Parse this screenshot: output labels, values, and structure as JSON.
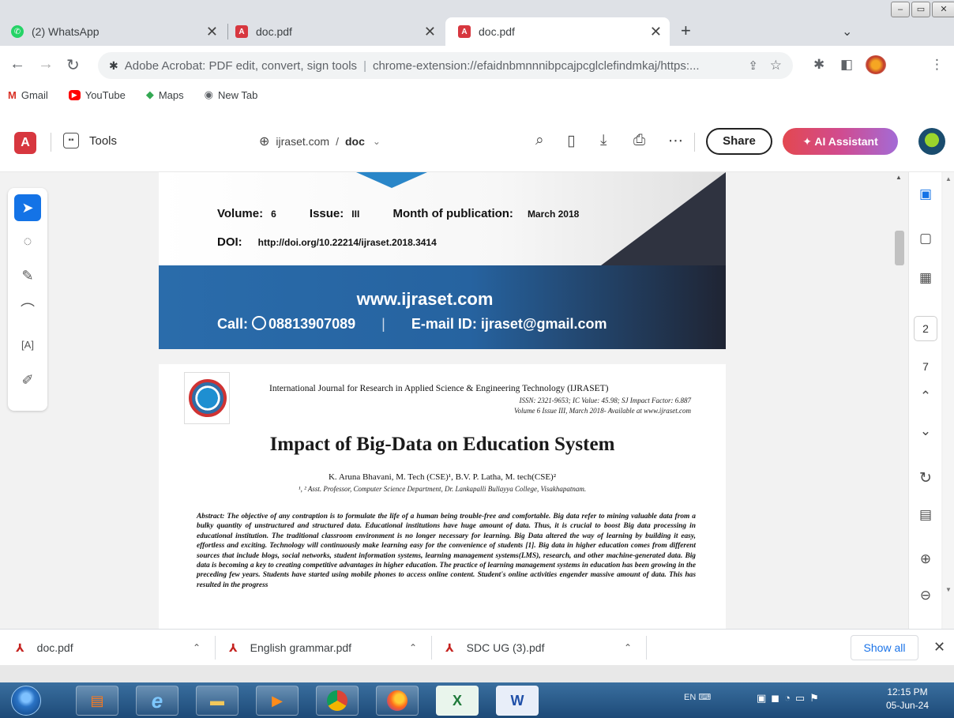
{
  "browser": {
    "tabs": [
      {
        "title": "(2) WhatsApp",
        "icon": "whatsapp-icon",
        "active": false
      },
      {
        "title": "doc.pdf",
        "icon": "acrobat-icon",
        "active": false
      },
      {
        "title": "doc.pdf",
        "icon": "acrobat-icon",
        "active": true
      }
    ],
    "address_prefix": "Adobe Acrobat: PDF edit, convert, sign tools",
    "address_url": "chrome-extension://efaidnbmnnnibpcajpcglclefindmkaj/https:...",
    "bookmarks": [
      {
        "label": "Gmail",
        "icon": "gmail-icon"
      },
      {
        "label": "YouTube",
        "icon": "youtube-icon"
      },
      {
        "label": "Maps",
        "icon": "maps-icon"
      },
      {
        "label": "New Tab",
        "icon": "globe-icon"
      }
    ]
  },
  "acrobat": {
    "tools_label": "Tools",
    "domain": "ijraset.com",
    "doc_name": "doc",
    "share_label": "Share",
    "ai_label": "AI Assistant",
    "current_page": "2",
    "total_pages": "7",
    "accent_color": "#1473e6",
    "brand_color": "#d7373f"
  },
  "page1": {
    "volume_label": "Volume:",
    "volume_value": "6",
    "issue_label": "Issue:",
    "issue_value": "III",
    "month_label": "Month of publication:",
    "month_value": "March 2018",
    "doi_label": "DOI:",
    "doi_value": "http://doi.org/10.22214/ijraset.2018.3414",
    "website": "www.ijraset.com",
    "call_label": "Call:",
    "phone": "08813907089",
    "email": "E-mail ID: ijraset@gmail.com"
  },
  "page2": {
    "journal": "International Journal for Research in Applied Science & Engineering Technology (IJRASET)",
    "issn": "ISSN: 2321-9653; IC Value: 45.98; SJ Impact Factor: 6.887",
    "volume": "Volume 6 Issue III, March 2018- Available at www.ijraset.com",
    "title": "Impact of Big-Data on Education System",
    "authors": "K. Aruna Bhavani, M. Tech (CSE)¹,  B.V. P. Latha, M. tech(CSE)²",
    "affiliation": "¹, ² Asst. Professor, Computer Science Department, Dr. Lankapalli Bullayya College,  Visakhapatnam.",
    "abstract": "Abstract: The objective of any contraption is to formulate the life of a human being trouble-free and comfortable. Big data refer to mining valuable data from a bulky quantity of unstructured and structured data. Educational institutions have  huge amount of data. Thus, it is crucial to boost Big data processing in educational institution. The traditional classroom environment is no longer necessary for learning.  Big Data  altered the way of learning by building it easy, effortless and exciting. Technology will continuously make learning easy for the convenience of students [1]. Big data in higher education comes from different sources that include blogs, social networks, student information systems, learning management systems(LMS), research, and other machine-generated data.  Big data is becoming a key to creating competitive advantages in higher education. The practice of learning management systems in education has been growing in the preceding few years. Students have started using mobile phones to access online content. Student's online activities engender massive amount of data. This has resulted in the progress"
  },
  "downloads": {
    "items": [
      "doc.pdf",
      "English grammar.pdf",
      "SDC UG (3).pdf"
    ],
    "show_all": "Show all"
  },
  "taskbar": {
    "lang": "EN",
    "time": "12:15 PM",
    "date": "05-Jun-24"
  }
}
